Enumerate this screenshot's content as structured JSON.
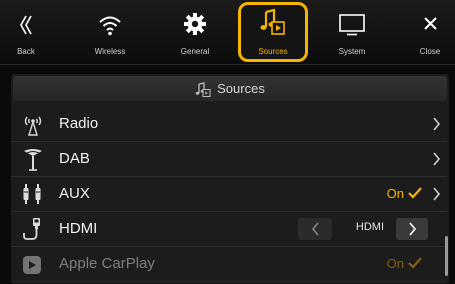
{
  "tabs": [
    {
      "label": "Back",
      "icon": "back-double-chevron-icon"
    },
    {
      "label": "Wireless",
      "icon": "wifi-icon"
    },
    {
      "label": "General",
      "icon": "gear-icon"
    },
    {
      "label": "Sources",
      "icon": "music-source-icon",
      "active": true
    },
    {
      "label": "System",
      "icon": "monitor-icon"
    },
    {
      "label": "Close",
      "icon": "close-icon"
    }
  ],
  "header": {
    "title": "Sources",
    "icon": "music-source-icon"
  },
  "rows": [
    {
      "label": "Radio",
      "icon": "radio-antenna-icon"
    },
    {
      "label": "DAB",
      "icon": "dab-antenna-icon"
    },
    {
      "label": "AUX",
      "icon": "aux-plug-icon",
      "value": "On"
    },
    {
      "label": "HDMI",
      "icon": "hdmi-cable-icon",
      "value": "HDMI"
    },
    {
      "label": "Apple CarPlay",
      "icon": "carplay-icon",
      "value": "On"
    }
  ],
  "colors": {
    "accent": "#f5b400",
    "background": "#0a0a0a",
    "panel": "#1c1c1c"
  }
}
